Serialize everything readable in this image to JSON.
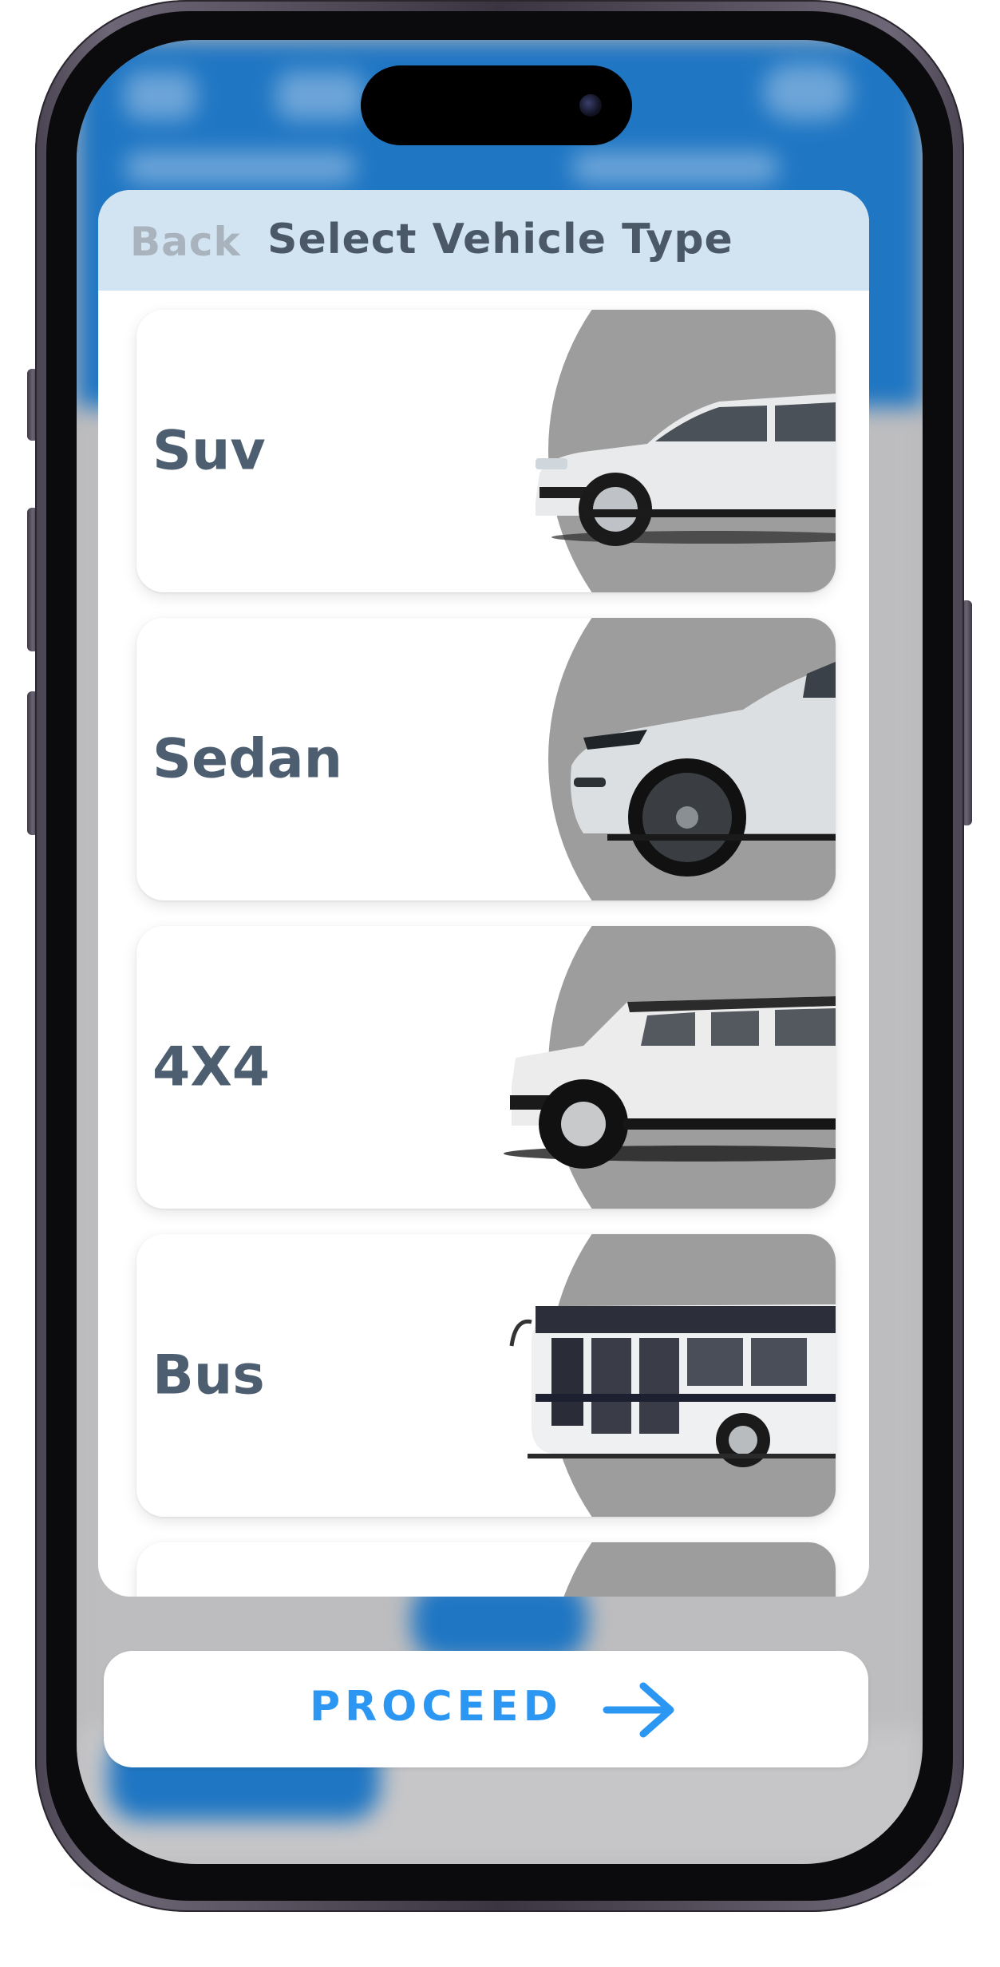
{
  "modal": {
    "back_label": "Back",
    "title": "Select Vehicle Type"
  },
  "vehicles": [
    {
      "label": "Suv",
      "icon": "suv-photo"
    },
    {
      "label": "Sedan",
      "icon": "sedan-photo"
    },
    {
      "label": "4X4",
      "icon": "4x4-photo"
    },
    {
      "label": "Bus",
      "icon": "bus-photo"
    }
  ],
  "proceed": {
    "label": "PROCEED",
    "icon": "arrow-right-icon"
  },
  "colors": {
    "header_blue": "#1f76c3",
    "modal_header": "#d2e3f2",
    "accent": "#2b97f2",
    "label_text": "#4c5e70",
    "photo_bg": "#9d9d9d"
  }
}
